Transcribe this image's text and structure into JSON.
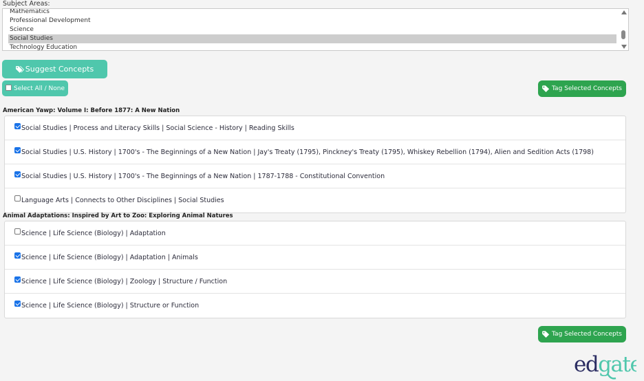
{
  "subject_areas": {
    "label": "Subject Areas:",
    "options": [
      {
        "label": "Mathematics",
        "selected": false
      },
      {
        "label": "Professional Development",
        "selected": false
      },
      {
        "label": "Science",
        "selected": false
      },
      {
        "label": "Social Studies",
        "selected": true
      },
      {
        "label": "Technology Education",
        "selected": false
      }
    ]
  },
  "buttons": {
    "suggest_label": "Suggest Concepts",
    "select_all_label": "Select All / None",
    "tag_selected_label": "Tag Selected Concepts"
  },
  "sections": [
    {
      "title": "American Yawp: Volume I: Before 1877: A New Nation",
      "concepts": [
        {
          "label": "Social Studies | Process and Literacy Skills | Social Science - History | Reading Skills",
          "checked": true
        },
        {
          "label": "Social Studies | U.S. History | 1700's - The Beginnings of a New Nation | Jay's Treaty (1795), Pinckney's Treaty (1795), Whiskey Rebellion (1794), Alien and Sedition Acts (1798)",
          "checked": true
        },
        {
          "label": "Social Studies | U.S. History | 1700's - The Beginnings of a New Nation | 1787-1788 - Constitutional Convention",
          "checked": true
        },
        {
          "label": "Language Arts | Connects to Other Disciplines | Social Studies",
          "checked": false
        }
      ]
    },
    {
      "title": "Animal Adaptations: Inspired by Art to Zoo: Exploring Animal Natures",
      "concepts": [
        {
          "label": "Science | Life Science (Biology) | Adaptation",
          "checked": false
        },
        {
          "label": "Science | Life Science (Biology) | Adaptation | Animals",
          "checked": true
        },
        {
          "label": "Science | Life Science (Biology) | Zoology | Structure / Function",
          "checked": true
        },
        {
          "label": "Science | Life Science (Biology) | Structure or Function",
          "checked": true
        }
      ]
    }
  ],
  "logo": {
    "text": "edgate"
  },
  "colors": {
    "teal": "#4fc7ac",
    "green": "#2ea44f",
    "logo_navy": "#2b2d62",
    "checkbox_blue": "#1a73e8"
  }
}
